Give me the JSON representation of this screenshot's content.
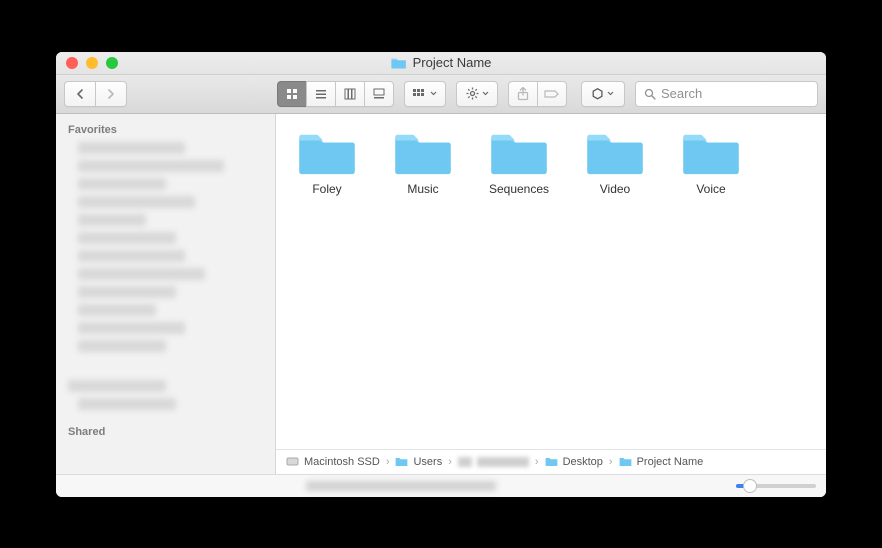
{
  "window": {
    "title": "Project Name"
  },
  "toolbar": {
    "search_placeholder": "Search"
  },
  "sidebar": {
    "favorites_label": "Favorites",
    "shared_label": "Shared"
  },
  "folders": [
    {
      "name": "Foley"
    },
    {
      "name": "Music"
    },
    {
      "name": "Sequences"
    },
    {
      "name": "Video"
    },
    {
      "name": "Voice"
    }
  ],
  "path": {
    "disk": "Macintosh SSD",
    "users": "Users",
    "desktop": "Desktop",
    "current": "Project Name"
  }
}
